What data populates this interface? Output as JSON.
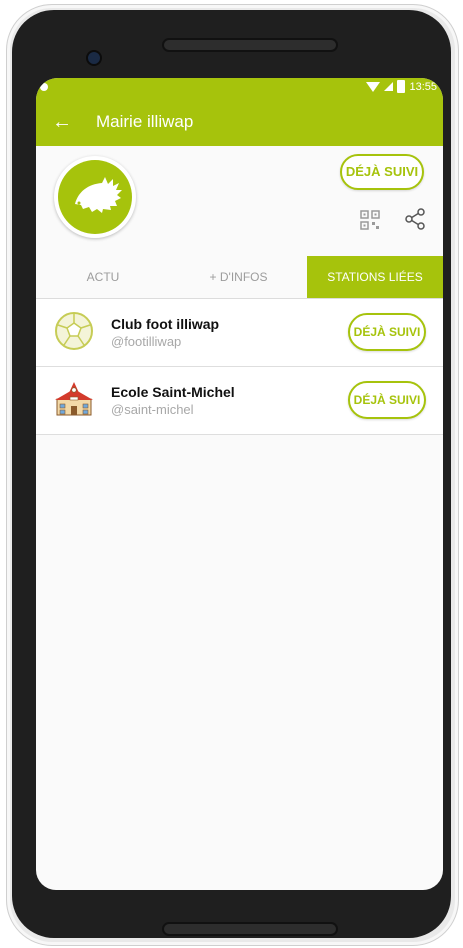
{
  "status_bar": {
    "time": "13:55"
  },
  "app_bar": {
    "title": "Mairie illiwap",
    "back_icon": "arrow-left-icon"
  },
  "profile": {
    "follow_label": "DÉJÀ SUIVI",
    "avatar_icon": "hedgehog-icon",
    "qr_icon": "qr-code-icon",
    "share_icon": "share-icon"
  },
  "tabs": [
    {
      "label": "ACTU",
      "active": false
    },
    {
      "label": "+ D'INFOS",
      "active": false
    },
    {
      "label": "STATIONS LIÉES",
      "active": true
    }
  ],
  "linked_stations": [
    {
      "name": "Club foot illiwap",
      "handle": "@footilliwap",
      "follow_label": "DÉJÀ SUIVI",
      "icon": "soccer-ball-icon"
    },
    {
      "name": "Ecole Saint-Michel",
      "handle": "@saint-michel",
      "follow_label": "DÉJÀ SUIVI",
      "icon": "school-building-icon"
    }
  ],
  "colors": {
    "accent": "#a6c30c",
    "background": "#fafafa",
    "text": "#111111",
    "muted": "#a8a8a8"
  }
}
